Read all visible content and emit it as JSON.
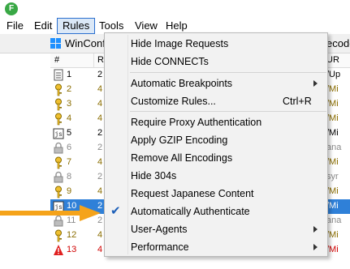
{
  "app": {
    "icon_letter": "F"
  },
  "menubar": {
    "file": "File",
    "edit": "Edit",
    "rules": "Rules",
    "tools": "Tools",
    "view": "View",
    "help": "Help"
  },
  "toolbar": {
    "winconfig": "WinConf",
    "decode": "ecode"
  },
  "grid": {
    "headers": {
      "num": "#",
      "result": "Re",
      "url": "UR"
    },
    "rows": [
      {
        "num": "1",
        "result": "2",
        "url": "/Up",
        "icon": "document-icon",
        "color": "#000000"
      },
      {
        "num": "2",
        "result": "4",
        "url": "/Mi",
        "icon": "key-icon",
        "color": "#8a6d00"
      },
      {
        "num": "3",
        "result": "4",
        "url": "/Mi",
        "icon": "key-icon",
        "color": "#8a6d00"
      },
      {
        "num": "4",
        "result": "4",
        "url": "/Mi",
        "icon": "key-icon",
        "color": "#8a6d00"
      },
      {
        "num": "5",
        "result": "2",
        "url": "/Mi",
        "icon": "script-icon",
        "color": "#000000"
      },
      {
        "num": "6",
        "result": "2",
        "url": "ana",
        "icon": "lock-icon",
        "color": "#8a8a8a"
      },
      {
        "num": "7",
        "result": "4",
        "url": "/Mi",
        "icon": "key-icon",
        "color": "#8a6d00"
      },
      {
        "num": "8",
        "result": "2",
        "url": "syr",
        "icon": "lock-icon",
        "color": "#8a8a8a"
      },
      {
        "num": "9",
        "result": "4",
        "url": "/Mi",
        "icon": "key-icon",
        "color": "#8a6d00"
      },
      {
        "num": "10",
        "result": "2",
        "url": "/Mi",
        "icon": "script-icon",
        "color": "#ffffff",
        "selected": true
      },
      {
        "num": "11",
        "result": "2",
        "url": "ana",
        "icon": "lock-icon",
        "color": "#8a8a8a"
      },
      {
        "num": "12",
        "result": "4",
        "url": "/Mi",
        "icon": "key-icon",
        "color": "#8a6d00"
      },
      {
        "num": "13",
        "result": "4",
        "url": "/Mi",
        "icon": "warning-icon",
        "color": "#d00000"
      }
    ]
  },
  "rules_menu": {
    "items": [
      {
        "label": "Hide Image Requests"
      },
      {
        "label": "Hide CONNECTs"
      },
      {
        "label": "Automatic Breakpoints",
        "submenu": true
      },
      {
        "label": "Customize Rules...",
        "shortcut": "Ctrl+R"
      },
      {
        "label": "Require Proxy Authentication"
      },
      {
        "label": "Apply GZIP Encoding"
      },
      {
        "label": "Remove All Encodings"
      },
      {
        "label": "Hide 304s"
      },
      {
        "label": "Request Japanese Content"
      },
      {
        "label": "Automatically Authenticate",
        "checked": true
      },
      {
        "label": "User-Agents",
        "submenu": true
      },
      {
        "label": "Performance",
        "submenu": true
      }
    ]
  },
  "colors": {
    "accent": "#2f80d8",
    "arrow": "#f5a31a",
    "check": "#1d5fb8",
    "menu_bg": "#f2f2f2"
  }
}
